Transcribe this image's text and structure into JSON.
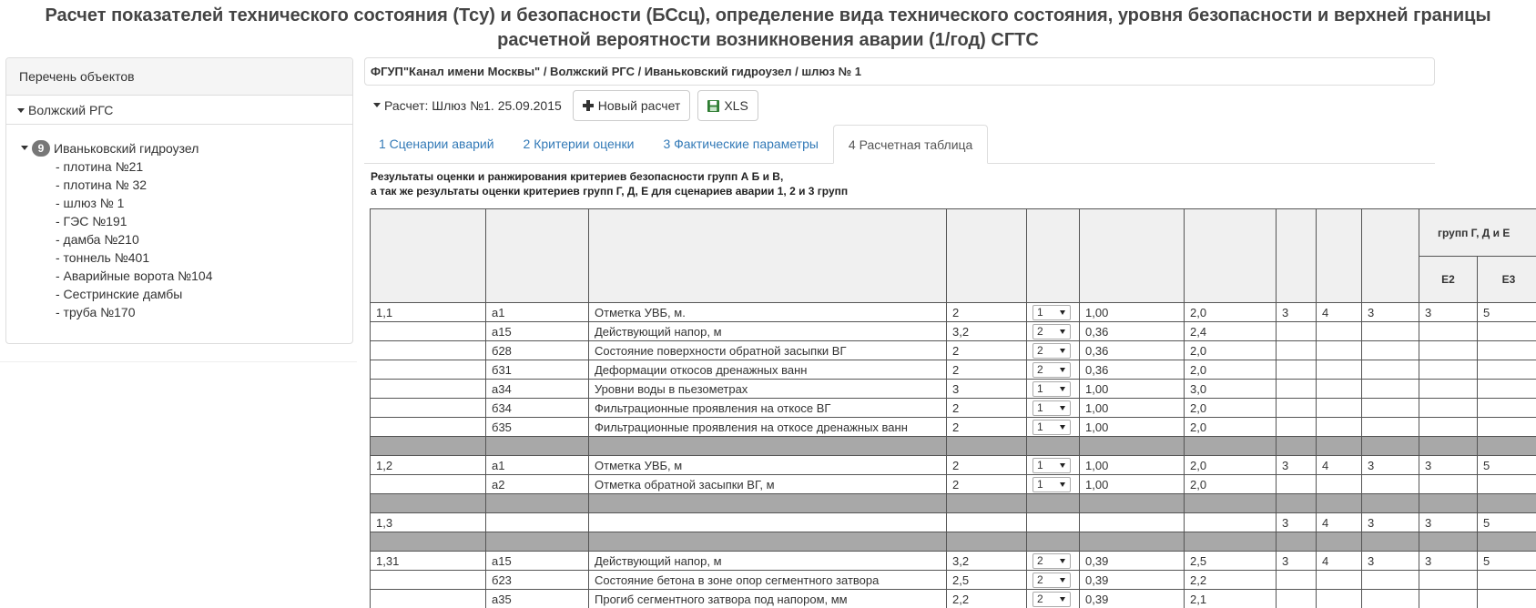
{
  "title_lines": [
    "Расчет показателей технического состояния (Тсу) и безопасности (БСсц), определение вида технического состояния, уровня безопасности и верхней границы",
    "расчетной вероятности возникновения аварии (1/год) СГТС"
  ],
  "sidebar": {
    "header": "Перечень объектов",
    "group": "Волжский РГС",
    "root": {
      "badge": "9",
      "label": "Иваньковский гидроузел"
    },
    "items": [
      "- плотина №21",
      "- плотина № 32",
      "- шлюз № 1",
      "- ГЭС №191",
      "- дамба №210",
      "- тоннель №401",
      "- Аварийные ворота №104",
      "- Сестринские дамбы",
      "- труба №170"
    ]
  },
  "breadcrumb": "ФГУП\"Канал имени Москвы\" / Волжский РГС / Иваньковский гидроузел / шлюз № 1",
  "toolbar": {
    "calc_label": "Расчет: Шлюз №1. 25.09.2015",
    "new_calc": "Новый расчет",
    "xls": "XLS"
  },
  "tabs": [
    "1 Сценарии аварий",
    "2 Критерии оценки",
    "3 Фактические параметры",
    "4 Расчетная таблица"
  ],
  "results_caption": [
    "Результаты оценки и ранжирования критериев безопасности групп А Б и В,",
    " а так же результаты оценки критериев групп Г, Д, Е для сценариев аварии 1, 2 и 3 групп"
  ],
  "table": {
    "header_group": "групп Г, Д и Е",
    "header_e2": "Е2",
    "header_e3": "Е3",
    "rows": [
      {
        "type": "data",
        "c1": "1,1",
        "c2": "а1",
        "c3": "Отметка УВБ, м.",
        "c4": "2",
        "sel": "1",
        "c6": "1,00",
        "c7": "2,0",
        "c8": "3",
        "c9": "4",
        "c10": "3",
        "c11": "3",
        "c12": "5"
      },
      {
        "type": "data",
        "c1": "",
        "c2": "а15",
        "c3": "Действующий напор, м",
        "c4": "3,2",
        "sel": "2",
        "c6": "0,36",
        "c7": "2,4",
        "c8": "",
        "c9": "",
        "c10": "",
        "c11": "",
        "c12": ""
      },
      {
        "type": "data",
        "c1": "",
        "c2": "б28",
        "c3": "Состояние поверхности обратной засыпки ВГ",
        "c4": "2",
        "sel": "2",
        "c6": "0,36",
        "c7": "2,0",
        "c8": "",
        "c9": "",
        "c10": "",
        "c11": "",
        "c12": ""
      },
      {
        "type": "data",
        "c1": "",
        "c2": "б31",
        "c3": "Деформации откосов дренажных ванн",
        "c4": "2",
        "sel": "2",
        "c6": "0,36",
        "c7": "2,0",
        "c8": "",
        "c9": "",
        "c10": "",
        "c11": "",
        "c12": ""
      },
      {
        "type": "data",
        "c1": "",
        "c2": "а34",
        "c3": "Уровни воды в пьезометрах",
        "c4": "3",
        "sel": "1",
        "c6": "1,00",
        "c7": "3,0",
        "c8": "",
        "c9": "",
        "c10": "",
        "c11": "",
        "c12": ""
      },
      {
        "type": "data",
        "c1": "",
        "c2": "б34",
        "c3": "Фильтрационные проявления на откосе ВГ",
        "c4": "2",
        "sel": "1",
        "c6": "1,00",
        "c7": "2,0",
        "c8": "",
        "c9": "",
        "c10": "",
        "c11": "",
        "c12": ""
      },
      {
        "type": "data",
        "c1": "",
        "c2": "б35",
        "c3": "Фильтрационные проявления на откосе дренажных ванн",
        "c4": "2",
        "sel": "1",
        "c6": "1,00",
        "c7": "2,0",
        "c8": "",
        "c9": "",
        "c10": "",
        "c11": "",
        "c12": ""
      },
      {
        "type": "sep"
      },
      {
        "type": "data",
        "c1": "1,2",
        "c2": "а1",
        "c3": "Отметка УВБ, м",
        "c4": "2",
        "sel": "1",
        "c6": "1,00",
        "c7": "2,0",
        "c8": "3",
        "c9": "4",
        "c10": "3",
        "c11": "3",
        "c12": "5"
      },
      {
        "type": "data",
        "c1": "",
        "c2": "а2",
        "c3": "Отметка обратной засыпки ВГ, м",
        "c4": "2",
        "sel": "1",
        "c6": "1,00",
        "c7": "2,0",
        "c8": "",
        "c9": "",
        "c10": "",
        "c11": "",
        "c12": ""
      },
      {
        "type": "sep"
      },
      {
        "type": "data",
        "c1": "1,3",
        "c2": "",
        "c3": "",
        "c4": "",
        "sel": "",
        "c6": "",
        "c7": "",
        "c8": "3",
        "c9": "4",
        "c10": "3",
        "c11": "3",
        "c12": "5"
      },
      {
        "type": "sep"
      },
      {
        "type": "data",
        "c1": "1,31",
        "c2": "а15",
        "c3": "Действующий напор, м",
        "c4": "3,2",
        "sel": "2",
        "c6": "0,39",
        "c7": "2,5",
        "c8": "3",
        "c9": "4",
        "c10": "3",
        "c11": "3",
        "c12": "5"
      },
      {
        "type": "data",
        "c1": "",
        "c2": "б23",
        "c3": "Состояние бетона в зоне опор сегментного затвора",
        "c4": "2,5",
        "sel": "2",
        "c6": "0,39",
        "c7": "2,2",
        "c8": "",
        "c9": "",
        "c10": "",
        "c11": "",
        "c12": ""
      },
      {
        "type": "data",
        "c1": "",
        "c2": "а35",
        "c3": "Прогиб сегментного затвора под напором, мм",
        "c4": "2,2",
        "sel": "2",
        "c6": "0,39",
        "c7": "2,1",
        "c8": "",
        "c9": "",
        "c10": "",
        "c11": "",
        "c12": ""
      }
    ]
  }
}
